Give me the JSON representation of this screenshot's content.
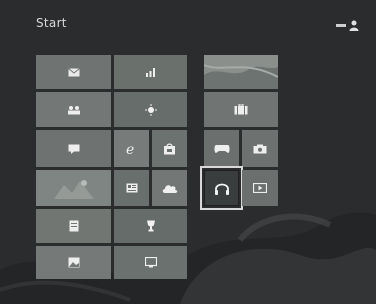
{
  "screen": {
    "title": "Start",
    "background_color": "#2b2c2e",
    "accent_color": "#6e7470"
  },
  "user": {
    "avatar_icon": "user-icon"
  },
  "tiles": [
    {
      "name": "mail-tile",
      "icon": "mail-icon",
      "color": "#6f7472"
    },
    {
      "name": "finance-tile",
      "icon": "chart-icon",
      "color": "#6a716d"
    },
    {
      "name": "people-tile",
      "icon": "people-icon",
      "color": "#737776"
    },
    {
      "name": "weather-tile",
      "icon": "sun-icon",
      "color": "#676d6a"
    },
    {
      "name": "messaging-tile",
      "icon": "chat-icon",
      "color": "#6e7371"
    },
    {
      "name": "internet-explorer-tile",
      "icon": "ie-icon",
      "color": "#777b79"
    },
    {
      "name": "store-tile",
      "icon": "store-icon",
      "color": "#6c7270"
    },
    {
      "name": "photos-tile",
      "icon": "photo-icon",
      "color": "#7f8582"
    },
    {
      "name": "news-tile",
      "icon": "news-icon",
      "color": "#696f6c"
    },
    {
      "name": "skydrive-tile",
      "icon": "cloud-icon",
      "color": "#737876"
    },
    {
      "name": "reader-tile",
      "icon": "document-icon",
      "color": "#717673"
    },
    {
      "name": "sports-tile",
      "icon": "trophy-icon",
      "color": "#666c69"
    },
    {
      "name": "desktop-tile",
      "icon": "landscape-icon",
      "color": "#757a78"
    },
    {
      "name": "video-tile",
      "icon": "monitor-icon",
      "color": "#6b716e"
    },
    {
      "name": "bing-maps-tile",
      "icon": "map-icon",
      "color": "#8a8f8c"
    },
    {
      "name": "travel-tile",
      "icon": "luggage-icon",
      "color": "#707573"
    },
    {
      "name": "games-tile",
      "icon": "gamepad-icon",
      "color": "#6b706e"
    },
    {
      "name": "camera-tile",
      "icon": "camera-icon",
      "color": "#6d7270"
    },
    {
      "name": "music-tile",
      "icon": "headphones-icon",
      "color": "#3a3d3e",
      "selected": true
    },
    {
      "name": "video-player-tile",
      "icon": "play-icon",
      "color": "#6b706e"
    }
  ]
}
